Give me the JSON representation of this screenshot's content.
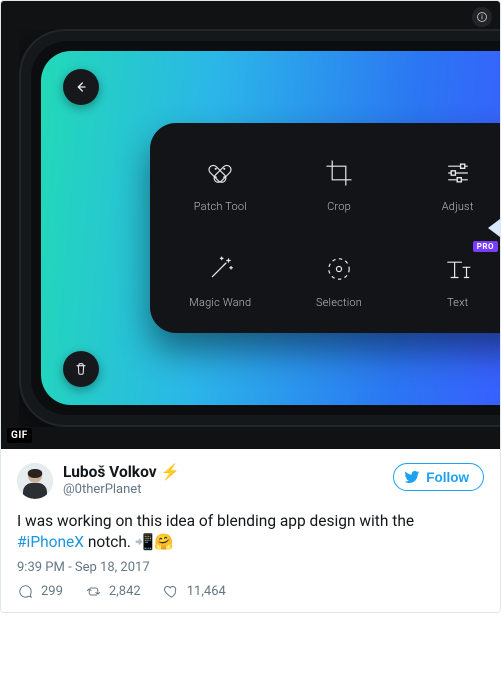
{
  "media": {
    "gif_badge": "GIF",
    "tools": {
      "patch": {
        "label": "Patch Tool"
      },
      "crop": {
        "label": "Crop"
      },
      "adjust": {
        "label": "Adjust"
      },
      "wand": {
        "label": "Magic Wand"
      },
      "selection": {
        "label": "Selection"
      },
      "text": {
        "label": "Text",
        "badge": "PRO"
      }
    }
  },
  "tweet": {
    "author": {
      "name": "Luboš Volkov",
      "bolt": "⚡",
      "handle": "@0therPlanet"
    },
    "follow_label": "Follow",
    "body_pre": "I was working on this idea of blending app design with the ",
    "hashtag": "#iPhoneX",
    "body_post": " notch. 📲🤗",
    "timestamp": "9:39 PM - Sep 18, 2017",
    "counts": {
      "replies": "299",
      "retweets": "2,842",
      "likes": "11,464"
    }
  }
}
